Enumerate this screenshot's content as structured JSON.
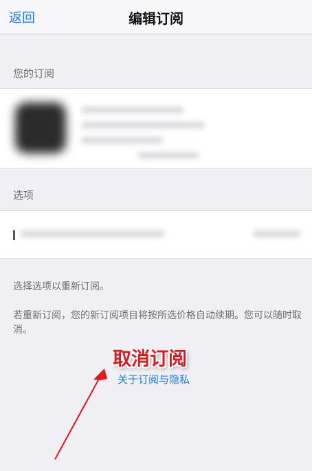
{
  "navbar": {
    "back_label": "返回",
    "title": "编辑订阅",
    "accent_color": "#1a7cf5"
  },
  "subscriptions": {
    "header": "您的订阅"
  },
  "options": {
    "header": "选项"
  },
  "notes": {
    "select_option": "选择选项以重新订阅。",
    "auto_renew": "若重新订阅，您的新订阅项目将按所选价格自动续期。您可以随时取消。"
  },
  "annotation": {
    "cancel_label": "取消订阅",
    "color": "#e4161b"
  },
  "privacy_link": "关于订阅与隐私"
}
